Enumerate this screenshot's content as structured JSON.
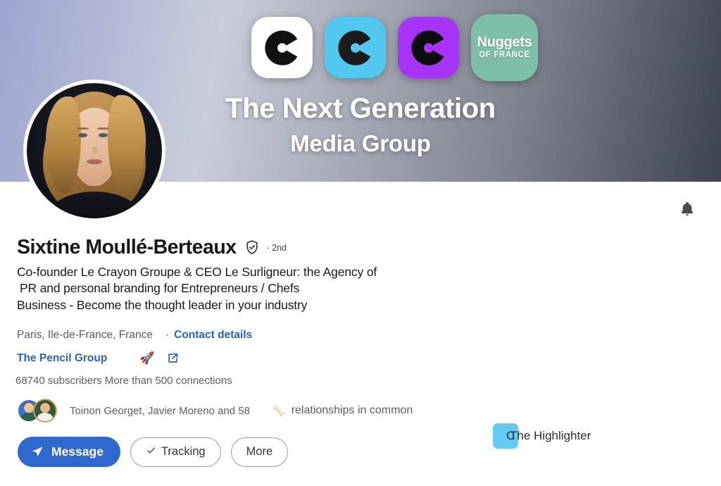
{
  "banner": {
    "title": "The Next Generation",
    "subtitle": "Media Group",
    "tiles": [
      {
        "icon_name": "le-crayon-logo-white",
        "bg": "#ffffff",
        "label": ""
      },
      {
        "icon_name": "le-crayon-logo-blue",
        "bg": "#52c7ef",
        "label": ""
      },
      {
        "icon_name": "le-crayon-logo-purple",
        "bg": "#a633f5",
        "label": ""
      },
      {
        "icon_name": "nuggets-of-france-logo",
        "bg": "#7ebfa8",
        "label_top": "Nuggets",
        "label_bottom": "OF FRANCE"
      }
    ],
    "gradient_from": "#4c5da8",
    "gradient_to": "#131c33"
  },
  "avatar": {
    "alt": "Sixtine Moullé-Berteaux profile photo",
    "ring_color": "#ffffff"
  },
  "notifications": {
    "icon_name": "bell-icon"
  },
  "profile": {
    "name": "Sixtine Moullé-Berteaux",
    "verified_icon": "verified-shield-icon",
    "degree": "· 2nd",
    "headline_line1": "Co-founder Le Crayon Groupe & CEO Le Surligneur: the Agency of",
    "headline_line2": "PR and personal branding for Entrepreneurs / Chefs",
    "headline_line3": "Business - Become the thought leader in your industry",
    "location": "Paris, Ile-de-France, France",
    "separator": "·",
    "contact_details": "Contact details",
    "company": "The Pencil Group",
    "rocket_emoji": "🚀",
    "external_link_icon": "external-link-icon",
    "stats": "68740 subscribers More than 500 connections"
  },
  "mutual": {
    "names": "Toinon Georget, Javier Moreno and 58",
    "emoji": "🦴",
    "suffix": "relationships in common"
  },
  "actions": {
    "message": "Message",
    "message_icon": "send-icon",
    "tracking": "Tracking",
    "tracking_icon": "check-icon",
    "more": "More"
  },
  "current_company": {
    "logo_letter": "C",
    "name": "The Highlighter",
    "logo_bg": "#63caf2"
  },
  "colors": {
    "accent_blue": "#2f69cf",
    "link_blue": "#2563c4",
    "text_primary": "#191919",
    "text_secondary": "#5c5c5c"
  }
}
